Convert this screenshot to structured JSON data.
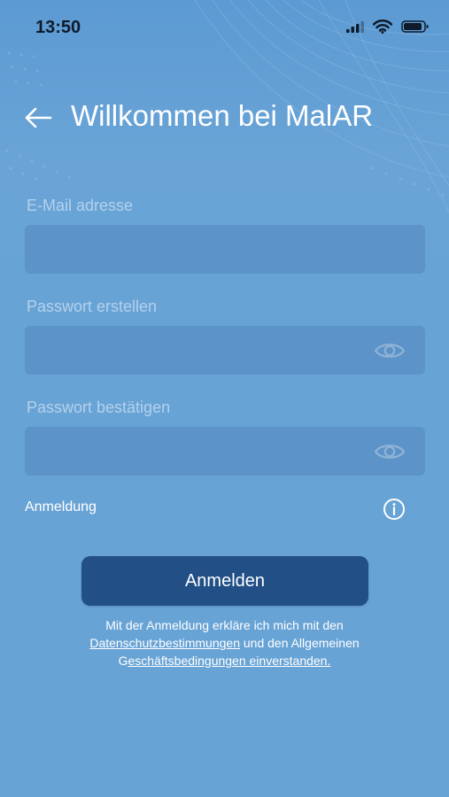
{
  "status_bar": {
    "time": "13:50"
  },
  "header": {
    "back_icon": "arrow-left-icon",
    "title": "Willkommen bei MalAR"
  },
  "form": {
    "email": {
      "label": "E-Mail adresse",
      "value": ""
    },
    "password": {
      "label": "Passwort erstellen",
      "value": "",
      "toggle_icon": "eye-icon"
    },
    "password_confirm": {
      "label": "Passwort bestätigen",
      "value": "",
      "toggle_icon": "eye-icon"
    },
    "anmeldung_label": "Anmeldung",
    "info_icon": "info-icon"
  },
  "submit": {
    "label": "Anmelden"
  },
  "legal": {
    "line1": "Mit der Anmeldung erkläre ich mich mit den",
    "privacy_link": "Datenschutzbestimmungen",
    "middle": " und den Allgemeinen",
    "prefix": "G",
    "terms_link": "eschäftsbedingungen einverstanden."
  },
  "colors": {
    "background": "#68a3d5",
    "field": "#5c93c8",
    "button": "#214f86",
    "label": "#b4d1ec",
    "text": "#ffffff"
  }
}
